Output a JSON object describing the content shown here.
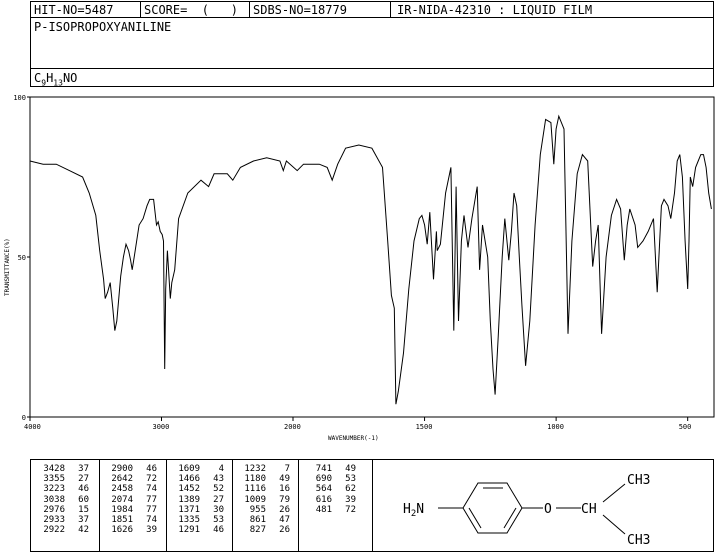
{
  "header": {
    "hit_no": "HIT-NO=5487",
    "score": "SCORE=  (   )",
    "sdbs_no": "SDBS-NO=18779",
    "ir_nida": "IR-NIDA-42310 : LIQUID FILM"
  },
  "compound": {
    "name": "P-ISOPROPOXYANILINE",
    "formula_parts": [
      "C",
      "9",
      "H",
      "13",
      "NO"
    ]
  },
  "chart_data": {
    "type": "line",
    "xlabel": "WAVENUMBER(-1)",
    "ylabel": "TRANSMITTANCE(%)",
    "xlim": [
      4000,
      400
    ],
    "ylim": [
      0,
      100
    ],
    "x_ticks": [
      "4000",
      "3000",
      "2000",
      "1500",
      "1000",
      "500"
    ],
    "y_ticks": [
      "100",
      "50",
      "0"
    ],
    "series": [
      {
        "points": [
          [
            4000,
            80
          ],
          [
            3900,
            79
          ],
          [
            3800,
            79
          ],
          [
            3700,
            77
          ],
          [
            3600,
            75
          ],
          [
            3550,
            70
          ],
          [
            3500,
            63
          ],
          [
            3470,
            52
          ],
          [
            3440,
            43
          ],
          [
            3428,
            37
          ],
          [
            3410,
            39
          ],
          [
            3390,
            42
          ],
          [
            3370,
            34
          ],
          [
            3355,
            27
          ],
          [
            3340,
            30
          ],
          [
            3310,
            44
          ],
          [
            3290,
            50
          ],
          [
            3270,
            54
          ],
          [
            3250,
            52
          ],
          [
            3235,
            49
          ],
          [
            3223,
            46
          ],
          [
            3200,
            52
          ],
          [
            3170,
            60
          ],
          [
            3140,
            62
          ],
          [
            3110,
            66
          ],
          [
            3090,
            68
          ],
          [
            3060,
            68
          ],
          [
            3038,
            60
          ],
          [
            3025,
            61
          ],
          [
            3010,
            58
          ],
          [
            2995,
            57
          ],
          [
            2985,
            55
          ],
          [
            2976,
            15
          ],
          [
            2968,
            40
          ],
          [
            2955,
            52
          ],
          [
            2933,
            37
          ],
          [
            2922,
            42
          ],
          [
            2900,
            46
          ],
          [
            2870,
            62
          ],
          [
            2800,
            70
          ],
          [
            2700,
            74
          ],
          [
            2642,
            72
          ],
          [
            2600,
            76
          ],
          [
            2550,
            76
          ],
          [
            2500,
            76
          ],
          [
            2458,
            74
          ],
          [
            2400,
            78
          ],
          [
            2300,
            80
          ],
          [
            2200,
            81
          ],
          [
            2100,
            80
          ],
          [
            2074,
            77
          ],
          [
            2050,
            80
          ],
          [
            1984,
            77
          ],
          [
            1960,
            79
          ],
          [
            1900,
            79
          ],
          [
            1870,
            78
          ],
          [
            1851,
            74
          ],
          [
            1830,
            79
          ],
          [
            1800,
            84
          ],
          [
            1750,
            85
          ],
          [
            1700,
            84
          ],
          [
            1660,
            78
          ],
          [
            1640,
            55
          ],
          [
            1626,
            38
          ],
          [
            1615,
            34
          ],
          [
            1609,
            4
          ],
          [
            1600,
            8
          ],
          [
            1580,
            20
          ],
          [
            1560,
            40
          ],
          [
            1540,
            55
          ],
          [
            1520,
            62
          ],
          [
            1510,
            63
          ],
          [
            1500,
            60
          ],
          [
            1490,
            54
          ],
          [
            1480,
            64
          ],
          [
            1466,
            43
          ],
          [
            1455,
            58
          ],
          [
            1452,
            52
          ],
          [
            1440,
            54
          ],
          [
            1420,
            70
          ],
          [
            1400,
            78
          ],
          [
            1389,
            27
          ],
          [
            1380,
            72
          ],
          [
            1371,
            30
          ],
          [
            1360,
            55
          ],
          [
            1350,
            63
          ],
          [
            1335,
            53
          ],
          [
            1320,
            62
          ],
          [
            1300,
            72
          ],
          [
            1291,
            46
          ],
          [
            1280,
            60
          ],
          [
            1260,
            50
          ],
          [
            1250,
            30
          ],
          [
            1240,
            15
          ],
          [
            1232,
            7
          ],
          [
            1220,
            25
          ],
          [
            1205,
            50
          ],
          [
            1195,
            62
          ],
          [
            1180,
            49
          ],
          [
            1170,
            58
          ],
          [
            1160,
            70
          ],
          [
            1150,
            66
          ],
          [
            1140,
            50
          ],
          [
            1130,
            35
          ],
          [
            1116,
            16
          ],
          [
            1100,
            30
          ],
          [
            1080,
            60
          ],
          [
            1060,
            82
          ],
          [
            1040,
            93
          ],
          [
            1020,
            92
          ],
          [
            1009,
            79
          ],
          [
            1000,
            90
          ],
          [
            990,
            94
          ],
          [
            970,
            90
          ],
          [
            955,
            26
          ],
          [
            940,
            55
          ],
          [
            920,
            76
          ],
          [
            900,
            82
          ],
          [
            880,
            80
          ],
          [
            861,
            47
          ],
          [
            850,
            55
          ],
          [
            840,
            60
          ],
          [
            827,
            26
          ],
          [
            810,
            50
          ],
          [
            790,
            63
          ],
          [
            770,
            68
          ],
          [
            755,
            65
          ],
          [
            741,
            49
          ],
          [
            730,
            60
          ],
          [
            720,
            65
          ],
          [
            700,
            60
          ],
          [
            690,
            53
          ],
          [
            670,
            55
          ],
          [
            650,
            58
          ],
          [
            630,
            62
          ],
          [
            616,
            39
          ],
          [
            600,
            66
          ],
          [
            590,
            68
          ],
          [
            575,
            66
          ],
          [
            564,
            62
          ],
          [
            550,
            70
          ],
          [
            540,
            80
          ],
          [
            530,
            82
          ],
          [
            520,
            75
          ],
          [
            510,
            55
          ],
          [
            500,
            40
          ],
          [
            495,
            55
          ],
          [
            490,
            75
          ],
          [
            481,
            72
          ],
          [
            470,
            78
          ],
          [
            460,
            80
          ],
          [
            450,
            82
          ],
          [
            440,
            82
          ],
          [
            430,
            78
          ],
          [
            420,
            70
          ],
          [
            410,
            65
          ]
        ]
      }
    ]
  },
  "peak_table": {
    "columns": [
      [
        [
          "3428",
          "37"
        ],
        [
          "3355",
          "27"
        ],
        [
          "3223",
          "46"
        ],
        [
          "3038",
          "60"
        ],
        [
          "2976",
          "15"
        ],
        [
          "2933",
          "37"
        ],
        [
          "2922",
          "42"
        ]
      ],
      [
        [
          "2900",
          "46"
        ],
        [
          "2642",
          "72"
        ],
        [
          "2458",
          "74"
        ],
        [
          "2074",
          "77"
        ],
        [
          "1984",
          "77"
        ],
        [
          "1851",
          "74"
        ],
        [
          "1626",
          "39"
        ]
      ],
      [
        [
          "1609",
          "4"
        ],
        [
          "1466",
          "43"
        ],
        [
          "1452",
          "52"
        ],
        [
          "1389",
          "27"
        ],
        [
          "1371",
          "30"
        ],
        [
          "1335",
          "53"
        ],
        [
          "1291",
          "46"
        ]
      ],
      [
        [
          "1232",
          "7"
        ],
        [
          "1180",
          "49"
        ],
        [
          "1116",
          "16"
        ],
        [
          "1009",
          "79"
        ],
        [
          "955",
          "26"
        ],
        [
          "861",
          "47"
        ],
        [
          "827",
          "26"
        ]
      ],
      [
        [
          "741",
          "49"
        ],
        [
          "690",
          "53"
        ],
        [
          "564",
          "62"
        ],
        [
          "616",
          "39"
        ],
        [
          "481",
          "72"
        ]
      ]
    ]
  },
  "structure": {
    "amine": "H2N",
    "oxygen": "O",
    "ch": "CH",
    "ch3_top": "CH3",
    "ch3_bottom": "CH3"
  }
}
